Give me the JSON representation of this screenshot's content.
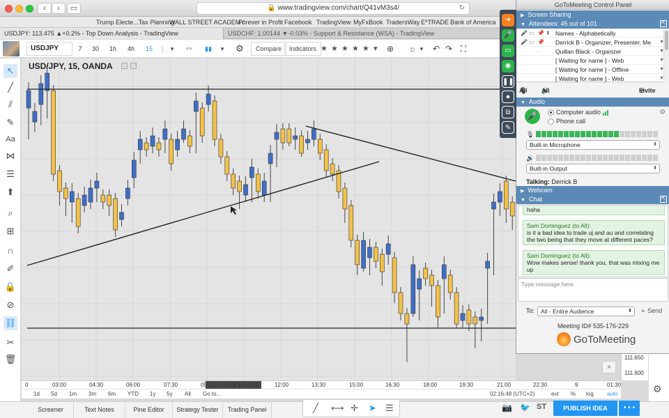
{
  "browser": {
    "url": "www.tradingview.com/chart/Q41vM3s4/",
    "bookmarks": [
      "Trump Electe...Tax Planning",
      "WALL STREET ACADEMY",
      "Forever in Profit",
      "Facebook",
      "TradingView",
      "MyFxBook",
      "TradersWay",
      "E*TRADE",
      "Bank of America"
    ],
    "tabs": [
      "USDJPY: 113.475 ▲+0.2% - Top Down Analysis - TradingView",
      "USDCHF: 1.00144 ▼-0.03% - Support & Resistance (WSA) - TradingView"
    ]
  },
  "toolbar": {
    "symbol": "USDJPY",
    "timeframes": [
      "7",
      "30",
      "1h",
      "4h",
      "15"
    ],
    "active_timeframe": "15",
    "compare": "Compare",
    "indicators": "Indicators"
  },
  "chart": {
    "legend": "USD/JPY, 15, OANDA",
    "time_labels": [
      "0",
      "03:00",
      "04:30",
      "06:00",
      "07:30",
      "09:00",
      "12:00",
      "13:30",
      "15:00",
      "16:30",
      "18:00",
      "19:30",
      "21:00",
      "22:30",
      "9",
      "01:30"
    ],
    "crosshair_time": "2017-02-08 10:00:00",
    "price_labels": [
      "111.650",
      "111.600"
    ],
    "ranges": [
      "1d",
      "5d",
      "1m",
      "3m",
      "6m",
      "YTD",
      "1y",
      "5y",
      "All",
      "Go to..."
    ],
    "clock": "02:16:48 (UTC+2)",
    "scale_opts": [
      "ext",
      "%",
      "log",
      "auto"
    ]
  },
  "chart_data": {
    "type": "candlestick",
    "series": [
      {
        "values": [
          [
            0,
            155,
            130,
            200,
            "bull"
          ],
          [
            1,
            175,
            160,
            190,
            "bull"
          ],
          [
            2,
            150,
            120,
            180,
            "bull"
          ],
          [
            3,
            130,
            105,
            170,
            "bull"
          ],
          [
            4,
            250,
            130,
            260,
            "bear"
          ],
          [
            5,
            275,
            245,
            295,
            "bear"
          ],
          [
            6,
            285,
            270,
            310,
            "bear"
          ],
          [
            7,
            290,
            275,
            320,
            "bull"
          ],
          [
            8,
            325,
            285,
            335,
            "bear"
          ],
          [
            9,
            295,
            280,
            305,
            "bull"
          ],
          [
            10,
            290,
            270,
            300,
            "bull"
          ],
          [
            11,
            270,
            260,
            290,
            "bull"
          ],
          [
            12,
            290,
            280,
            300,
            "bear"
          ],
          [
            13,
            295,
            280,
            310,
            "bear"
          ],
          [
            14,
            330,
            285,
            340,
            "bear"
          ],
          [
            15,
            315,
            305,
            325,
            "bull"
          ],
          [
            16,
            285,
            270,
            295,
            "bull"
          ],
          [
            17,
            255,
            230,
            270,
            "bull"
          ],
          [
            18,
            215,
            200,
            235,
            "bull"
          ],
          [
            19,
            215,
            205,
            225,
            "bear"
          ],
          [
            20,
            210,
            195,
            220,
            "bull"
          ],
          [
            21,
            215,
            205,
            225,
            "bear"
          ],
          [
            22,
            200,
            185,
            220,
            "bull"
          ],
          [
            23,
            235,
            200,
            245,
            "bear"
          ],
          [
            24,
            215,
            200,
            225,
            "bull"
          ],
          [
            25,
            200,
            185,
            205,
            "bull"
          ],
          [
            26,
            210,
            195,
            220,
            "bear"
          ],
          [
            27,
            160,
            145,
            220,
            "bull"
          ],
          [
            28,
            195,
            155,
            205,
            "bear"
          ],
          [
            29,
            150,
            135,
            160,
            "bull"
          ],
          [
            30,
            200,
            145,
            210,
            "bear"
          ],
          [
            31,
            225,
            200,
            235,
            "bear"
          ],
          [
            32,
            250,
            225,
            260,
            "bear"
          ],
          [
            33,
            270,
            250,
            280,
            "bear"
          ],
          [
            34,
            275,
            260,
            300,
            "bear"
          ],
          [
            35,
            280,
            265,
            290,
            "bull"
          ],
          [
            36,
            255,
            240,
            290,
            "bull"
          ],
          [
            37,
            275,
            250,
            285,
            "bear"
          ],
          [
            38,
            280,
            260,
            290,
            "bull"
          ],
          [
            39,
            235,
            220,
            290,
            "bull"
          ],
          [
            40,
            200,
            190,
            240,
            "bull"
          ],
          [
            41,
            205,
            185,
            215,
            "bear"
          ],
          [
            42,
            205,
            185,
            210,
            "bear"
          ],
          [
            43,
            200,
            195,
            215,
            "bull"
          ],
          [
            44,
            220,
            195,
            225,
            "bear"
          ],
          [
            45,
            205,
            200,
            215,
            "bull"
          ],
          [
            46,
            200,
            185,
            210,
            "bull"
          ],
          [
            47,
            220,
            200,
            230,
            "bear"
          ],
          [
            48,
            245,
            215,
            255,
            "bear"
          ],
          [
            49,
            250,
            235,
            260,
            "bear"
          ],
          [
            50,
            275,
            245,
            285,
            "bear"
          ],
          [
            51,
            300,
            270,
            320,
            "bear"
          ],
          [
            52,
            345,
            295,
            355,
            "bear"
          ],
          [
            53,
            380,
            345,
            395,
            "bear"
          ],
          [
            54,
            385,
            345,
            390,
            "bull"
          ],
          [
            55,
            370,
            355,
            395,
            "bull"
          ],
          [
            56,
            375,
            355,
            385,
            "bear"
          ],
          [
            57,
            390,
            365,
            410,
            "bear"
          ],
          [
            58,
            365,
            350,
            380,
            "bull"
          ],
          [
            59,
            420,
            370,
            435,
            "bear"
          ],
          [
            60,
            450,
            420,
            460,
            "bear"
          ],
          [
            61,
            465,
            450,
            520,
            "bear"
          ],
          [
            62,
            450,
            380,
            455,
            "bull"
          ],
          [
            63,
            415,
            400,
            460,
            "bull"
          ],
          [
            64,
            400,
            385,
            410,
            "bear"
          ],
          [
            65,
            410,
            395,
            440,
            "bear"
          ],
          [
            66,
            455,
            410,
            470,
            "bear"
          ],
          [
            67,
            400,
            380,
            450,
            "bull"
          ],
          [
            68,
            420,
            395,
            430,
            "bear"
          ],
          [
            69,
            465,
            420,
            470,
            "bear"
          ],
          [
            70,
            460,
            450,
            470,
            "bull"
          ],
          [
            71,
            465,
            445,
            475,
            "bear"
          ],
          [
            72,
            465,
            455,
            500,
            "bear"
          ],
          [
            73,
            460,
            455,
            490,
            "bull"
          ],
          [
            74,
            385,
            375,
            465,
            "bull"
          ],
          [
            75,
            300,
            290,
            395,
            "bull"
          ],
          [
            76,
            290,
            275,
            310,
            "bull"
          ],
          [
            77,
            300,
            260,
            320,
            "bear"
          ],
          [
            78,
            310,
            290,
            330,
            "bear"
          ],
          [
            79,
            330,
            300,
            340,
            "bull"
          ]
        ]
      }
    ],
    "support_line": 471,
    "resistance_line": 128
  },
  "bottom": {
    "panels": [
      "Screener",
      "Text Notes",
      "Pine Editor",
      "Strategy Tester",
      "Trading Panel"
    ],
    "publish": "PUBLISH IDEA"
  },
  "gtm": {
    "title": "GoToMeeting Control Panel",
    "screen_sharing": "Screen Sharing",
    "attendees": "Attendees: 45 out of 101",
    "sort_label": "Names - Alphabetically",
    "people": [
      "Derrick B - Organizer, Presenter, Me",
      "Quillan Black - Organizer",
      "[ Waiting for name ] - Web",
      "[ Waiting for name ] - Offline",
      "[ Waiting for name ] - Web"
    ],
    "all1": "All",
    "all2": "All",
    "invite": "Invite",
    "audio": "Audio",
    "computer_audio": "Computer audio",
    "phone_call": "Phone call",
    "mic": "Built-in Microphone",
    "output": "Built-in Output",
    "talking_label": "Talking:",
    "talking_name": "Derrick B",
    "webcam": "Webcam",
    "chat": "Chat",
    "chat_prev": "haha",
    "messages": [
      {
        "who": "Sam Dominguez (to All):",
        "text": "is it a bad idea to trade uj and au and correlating the two being that they move at different paces?"
      },
      {
        "who": "Sam Dominguez (to All):",
        "text": "Wow makes sense! thank you, that was mixing me up"
      }
    ],
    "type_placeholder": "Type message here.",
    "to_label": "To:",
    "to_value": "All - Entire Audience",
    "send": "Send",
    "meeting_id": "Meeting ID# 535-176-229",
    "logo": "GoToMeeting"
  }
}
